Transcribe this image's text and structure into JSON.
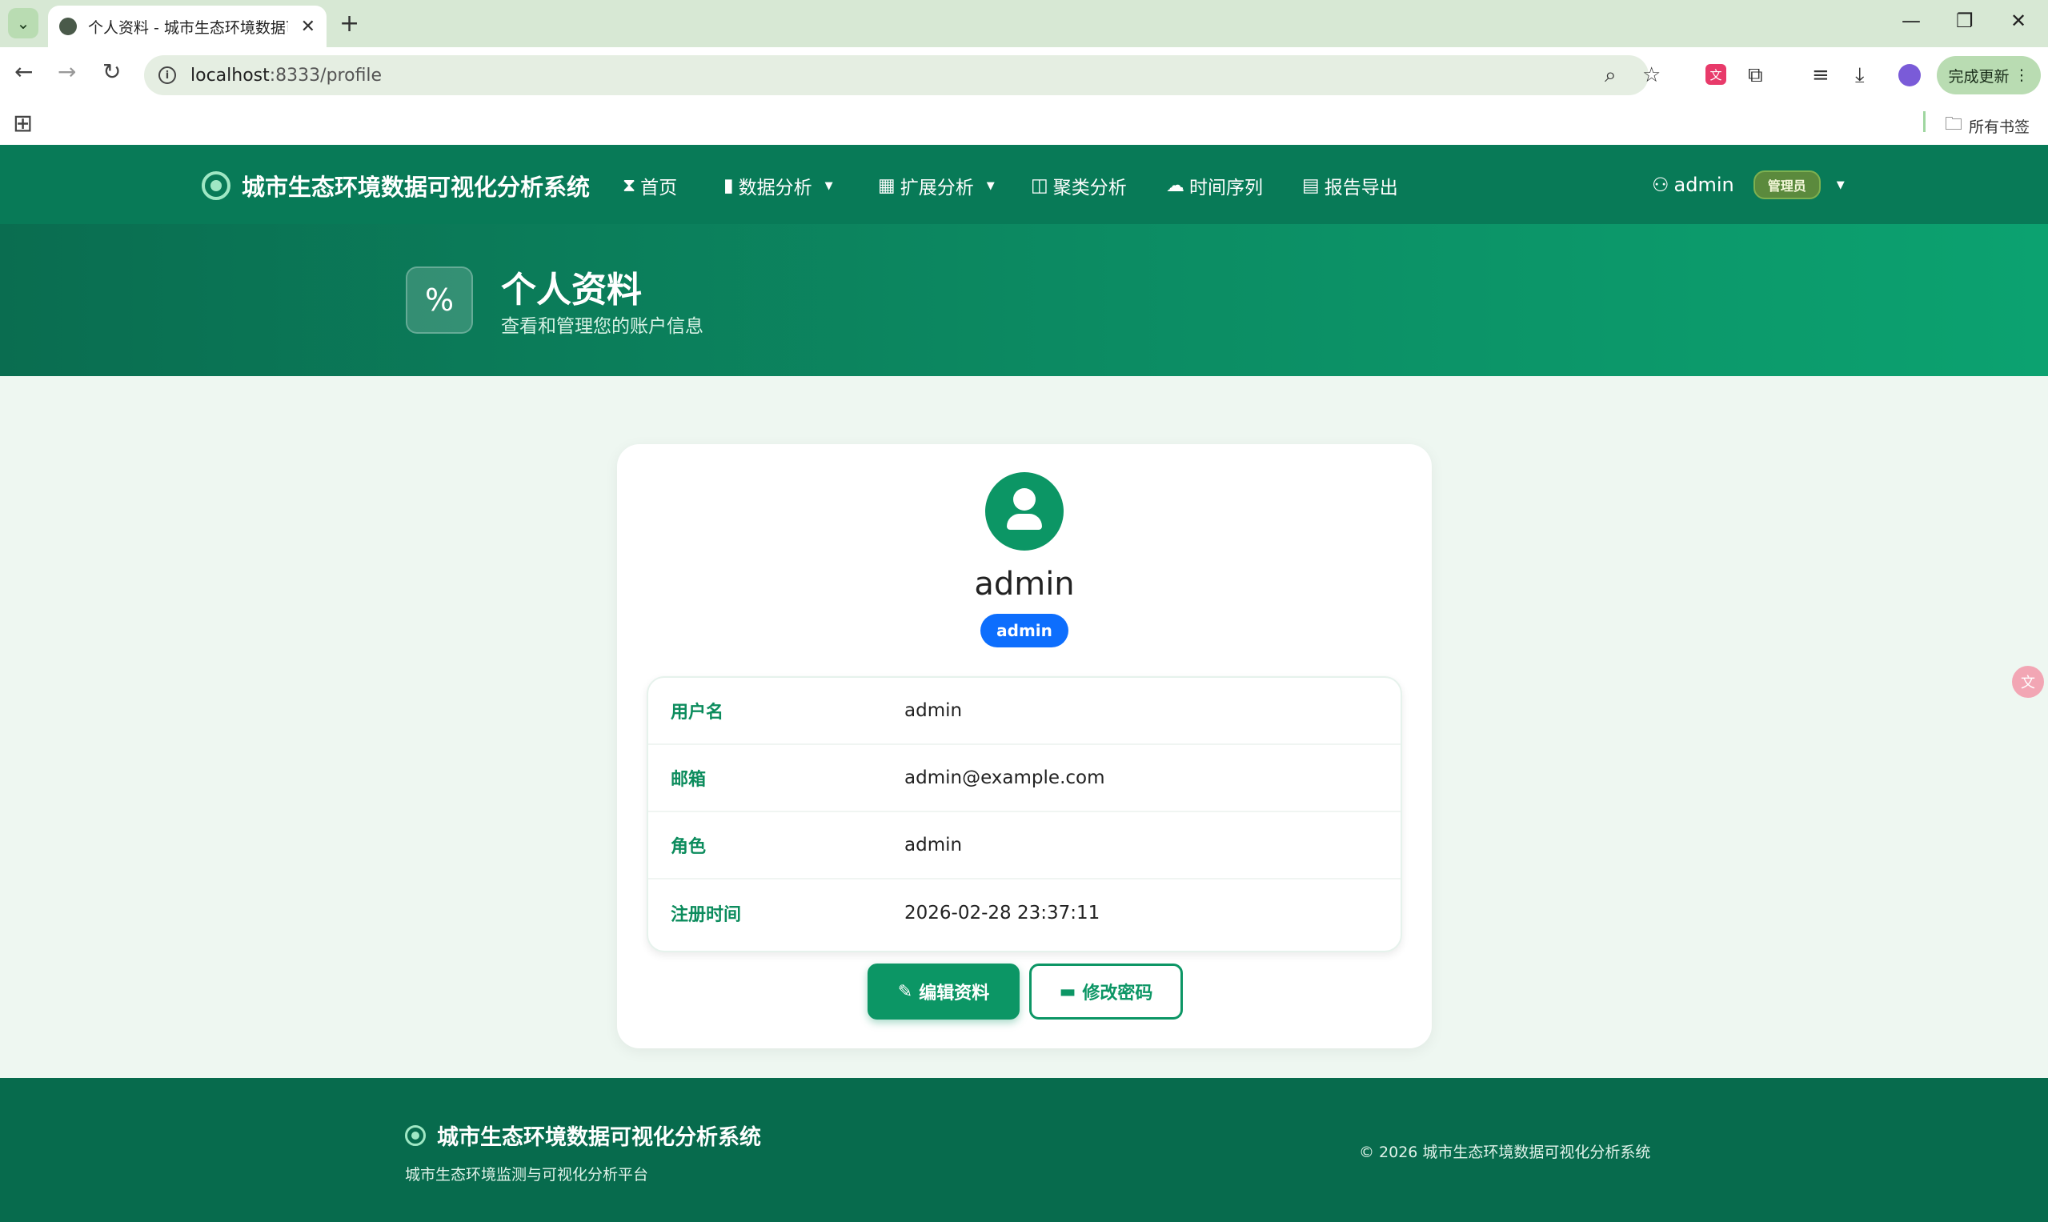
{
  "browser": {
    "tab_title": "个人资料 - 城市生态环境数据可视化分析系统",
    "url_host": "localhost",
    "url_rest": ":8333/profile",
    "update_label": "完成更新",
    "bookmarks_label": "所有书签"
  },
  "nav": {
    "brand": "城市生态环境数据可视化分析系统",
    "items": [
      {
        "label": "首页",
        "icon": "hourglass-icon"
      },
      {
        "label": "数据分析",
        "icon": "bar-chart-icon"
      },
      {
        "label": "扩展分析",
        "icon": "grid-icon"
      },
      {
        "label": "聚类分析",
        "icon": "panel-icon"
      },
      {
        "label": "时间序列",
        "icon": "cloud-icon"
      },
      {
        "label": "报告导出",
        "icon": "document-icon"
      }
    ],
    "user": "admin",
    "role_badge": "管理员"
  },
  "hero": {
    "title": "个人资料",
    "subtitle": "查看和管理您的账户信息"
  },
  "profile": {
    "name": "admin",
    "role": "admin",
    "fields": [
      {
        "label": "用户名",
        "value": "admin"
      },
      {
        "label": "邮箱",
        "value": "admin@example.com"
      },
      {
        "label": "角色",
        "value": "admin"
      },
      {
        "label": "注册时间",
        "value": "2026-02-28 23:37:11"
      }
    ],
    "edit_label": "编辑资料",
    "password_label": "修改密码"
  },
  "footer": {
    "brand": "城市生态环境数据可视化分析系统",
    "tagline": "城市生态环境监测与可视化分析平台",
    "copyright": "© 2026 城市生态环境数据可视化分析系统"
  },
  "colors": {
    "nav_bg": "#087a57",
    "accent": "#0c9665",
    "role_badge": "#0d6efd",
    "footer_bg": "#076b4d"
  }
}
